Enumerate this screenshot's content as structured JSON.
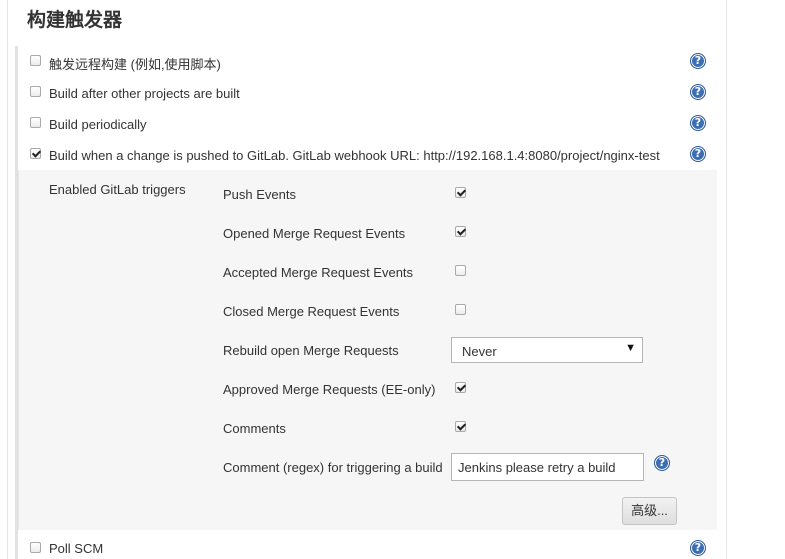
{
  "section": {
    "title": "构建触发器"
  },
  "triggers": [
    {
      "label": "触发远程构建 (例如,使用脚本)",
      "checked": false
    },
    {
      "label": "Build after other projects are built",
      "checked": false
    },
    {
      "label": "Build periodically",
      "checked": false
    },
    {
      "label": "Build when a change is pushed to GitLab. GitLab webhook URL: http://192.168.1.4:8080/project/nginx-test",
      "checked": true
    }
  ],
  "gitlab": {
    "enabled_label": "Enabled GitLab triggers",
    "options": [
      {
        "label": "Push Events",
        "checked": true
      },
      {
        "label": "Opened Merge Request Events",
        "checked": true
      },
      {
        "label": "Accepted Merge Request Events",
        "checked": false
      },
      {
        "label": "Closed Merge Request Events",
        "checked": false
      }
    ],
    "rebuild_label": "Rebuild open Merge Requests",
    "rebuild_value": "Never",
    "approved": {
      "label": "Approved Merge Requests (EE-only)",
      "checked": true
    },
    "comments": {
      "label": "Comments",
      "checked": true
    },
    "comment_regex_label": "Comment (regex) for triggering a build",
    "comment_regex_value": "Jenkins please retry a build",
    "advanced_button": "高级..."
  },
  "poll_scm": {
    "label": "Poll SCM",
    "checked": false
  },
  "icons": {
    "help": "help-icon",
    "select_arrow": "caret-down-icon"
  },
  "colors": {
    "help_blue": "#3c6eb4",
    "panel_bg": "#f6f6f6"
  }
}
